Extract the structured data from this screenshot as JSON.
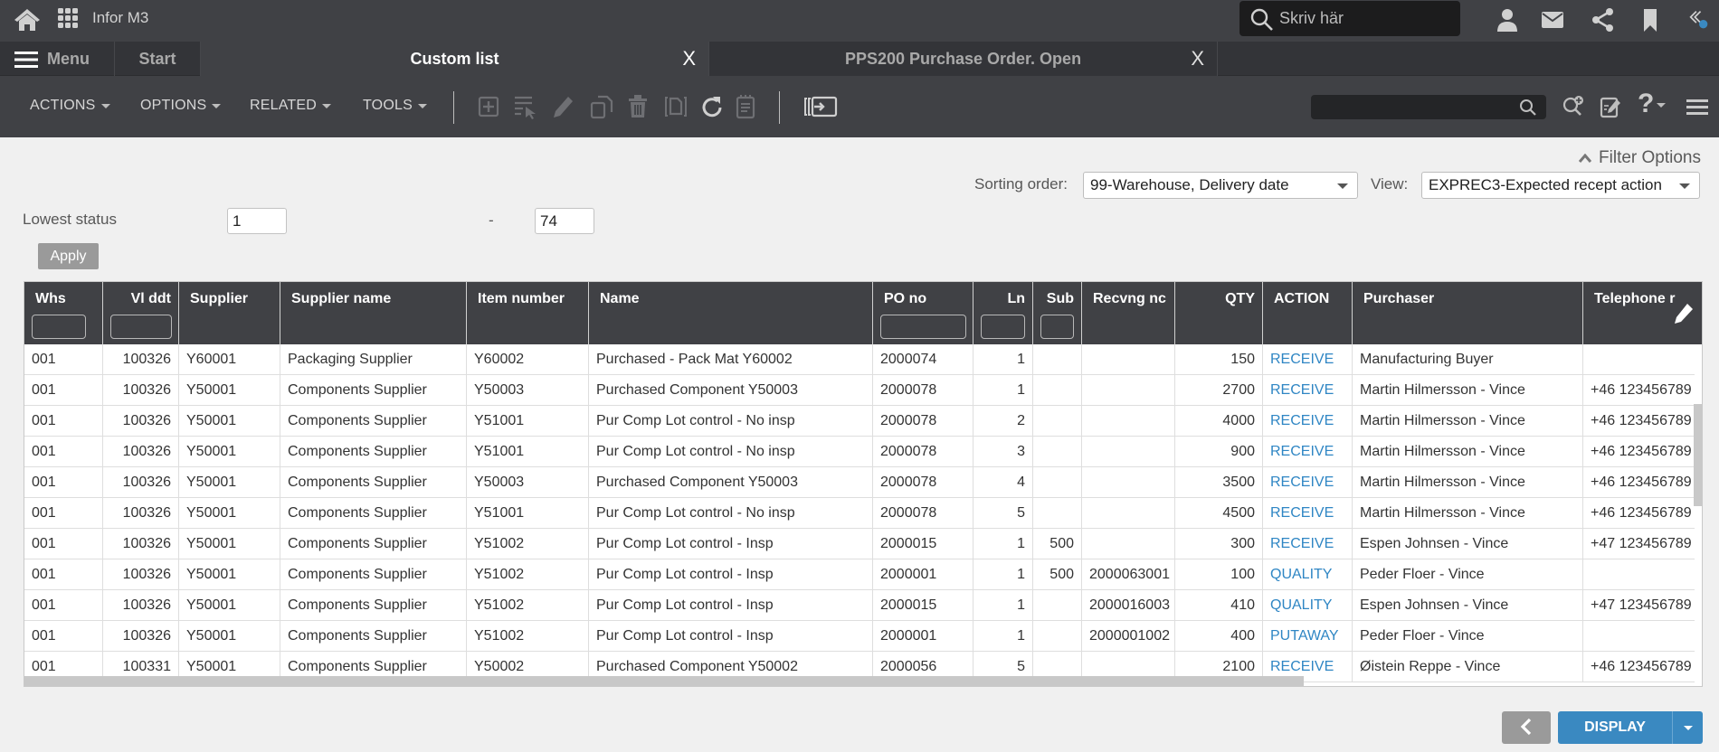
{
  "topbar": {
    "app_name": "Infor M3",
    "search_placeholder": "Skriv här",
    "icons": [
      "home-icon",
      "apps-grid-icon",
      "search-icon",
      "user-icon",
      "mail-icon",
      "share-icon",
      "bookmark-icon",
      "collapse-chevrons-icon"
    ],
    "notification_dot_color": "#3a89c1"
  },
  "tabs": {
    "menu_label": "Menu",
    "start_label": "Start",
    "items": [
      {
        "label": "Custom list",
        "active": true,
        "close": "X"
      },
      {
        "label": "PPS200 Purchase Order. Open",
        "active": false,
        "close": "X"
      }
    ]
  },
  "toolbar": {
    "menus": [
      {
        "label": "ACTIONS"
      },
      {
        "label": "OPTIONS"
      },
      {
        "label": "RELATED"
      },
      {
        "label": "TOOLS"
      }
    ],
    "icons": [
      "new-icon",
      "select-icon",
      "edit-icon",
      "copy-icon",
      "delete-icon",
      "display-icon",
      "refresh-icon",
      "notes-icon",
      "open-related-icon"
    ],
    "search_value": "",
    "right_icons": [
      "add-search-icon",
      "personalize-icon",
      "help-icon",
      "hamburger-menu-icon"
    ]
  },
  "filters": {
    "filter_options_label": "Filter Options",
    "sorting_order_label": "Sorting order:",
    "sorting_order_value": "99-Warehouse, Delivery date",
    "view_label": "View:",
    "view_value": "EXPREC3-Expected recept action",
    "lowest_status_label": "Lowest status",
    "lowest_status_from": "1",
    "range_separator": "-",
    "lowest_status_to": "74",
    "apply_label": "Apply"
  },
  "grid": {
    "columns": [
      {
        "label": "Whs",
        "filter": true
      },
      {
        "label": "Vl ddt",
        "filter": true
      },
      {
        "label": "Supplier",
        "filter": false
      },
      {
        "label": "Supplier name",
        "filter": false
      },
      {
        "label": "Item number",
        "filter": false
      },
      {
        "label": "Name",
        "filter": false
      },
      {
        "label": "PO no",
        "filter": true
      },
      {
        "label": "Ln",
        "filter": true
      },
      {
        "label": "Sub",
        "filter": true
      },
      {
        "label": "Recvng nc",
        "filter": false
      },
      {
        "label": "QTY",
        "filter": false
      },
      {
        "label": "ACTION",
        "filter": false
      },
      {
        "label": "Purchaser",
        "filter": false
      },
      {
        "label": "Telephone r",
        "filter": false
      }
    ],
    "rows": [
      [
        "001",
        "100326",
        "Y60001",
        "Packaging Supplier",
        "Y60002",
        "Purchased - Pack Mat Y60002",
        "2000074",
        "1",
        "",
        "",
        "150",
        "RECEIVE",
        "Manufacturing Buyer",
        ""
      ],
      [
        "001",
        "100326",
        "Y50001",
        "Components Supplier",
        "Y50003",
        "Purchased Component Y50003",
        "2000078",
        "1",
        "",
        "",
        "2700",
        "RECEIVE",
        "Martin Hilmersson - Vince",
        "+46 123456789"
      ],
      [
        "001",
        "100326",
        "Y50001",
        "Components Supplier",
        "Y51001",
        "Pur Comp Lot control - No insp",
        "2000078",
        "2",
        "",
        "",
        "4000",
        "RECEIVE",
        "Martin Hilmersson - Vince",
        "+46 123456789"
      ],
      [
        "001",
        "100326",
        "Y50001",
        "Components Supplier",
        "Y51001",
        "Pur Comp Lot control - No insp",
        "2000078",
        "3",
        "",
        "",
        "900",
        "RECEIVE",
        "Martin Hilmersson - Vince",
        "+46 123456789"
      ],
      [
        "001",
        "100326",
        "Y50001",
        "Components Supplier",
        "Y50003",
        "Purchased Component Y50003",
        "2000078",
        "4",
        "",
        "",
        "3500",
        "RECEIVE",
        "Martin Hilmersson - Vince",
        "+46 123456789"
      ],
      [
        "001",
        "100326",
        "Y50001",
        "Components Supplier",
        "Y51001",
        "Pur Comp Lot control - No insp",
        "2000078",
        "5",
        "",
        "",
        "4500",
        "RECEIVE",
        "Martin Hilmersson - Vince",
        "+46 123456789"
      ],
      [
        "001",
        "100326",
        "Y50001",
        "Components Supplier",
        "Y51002",
        "Pur Comp Lot control - Insp",
        "2000015",
        "1",
        "500",
        "",
        "300",
        "RECEIVE",
        "Espen Johnsen - Vince",
        "+47 123456789"
      ],
      [
        "001",
        "100326",
        "Y50001",
        "Components Supplier",
        "Y51002",
        "Pur Comp Lot control - Insp",
        "2000001",
        "1",
        "500",
        "2000063001",
        "100",
        "QUALITY",
        "Peder Floer - Vince",
        ""
      ],
      [
        "001",
        "100326",
        "Y50001",
        "Components Supplier",
        "Y51002",
        "Pur Comp Lot control - Insp",
        "2000015",
        "1",
        "",
        "2000016003",
        "410",
        "QUALITY",
        "Espen Johnsen - Vince",
        "+47 123456789"
      ],
      [
        "001",
        "100326",
        "Y50001",
        "Components Supplier",
        "Y51002",
        "Pur Comp Lot control - Insp",
        "2000001",
        "1",
        "",
        "2000001002",
        "400",
        "PUTAWAY",
        "Peder Floer - Vince",
        ""
      ],
      [
        "001",
        "100331",
        "Y50001",
        "Components Supplier",
        "Y50002",
        "Purchased Component Y50002",
        "2000056",
        "5",
        "",
        "",
        "2100",
        "RECEIVE",
        "Øistein Reppe - Vince",
        "+46 123456789"
      ]
    ],
    "action_color": "#2f86c4"
  },
  "footer": {
    "back_icon": "chevron-left-icon",
    "display_label": "DISPLAY",
    "display_color": "#3a89c1"
  }
}
